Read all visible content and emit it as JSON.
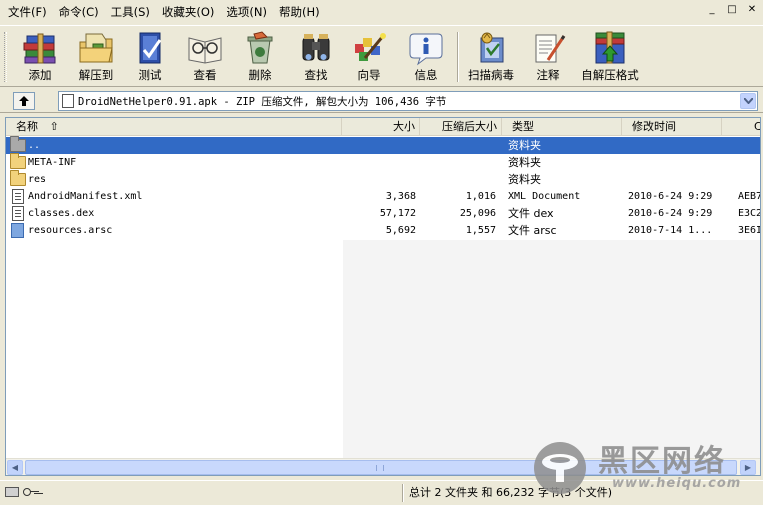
{
  "menu": [
    "文件(F)",
    "命令(C)",
    "工具(S)",
    "收藏夹(O)",
    "选项(N)",
    "帮助(H)"
  ],
  "window_controls": {
    "minimize": "_",
    "maximize": "□",
    "close": "✕"
  },
  "toolbar": {
    "add": "添加",
    "extract": "解压到",
    "test": "测试",
    "view": "查看",
    "delete": "删除",
    "find": "查找",
    "wizard": "向导",
    "info": "信息",
    "scan": "扫描病毒",
    "comment": "注释",
    "sfx": "自解压格式"
  },
  "address": {
    "path": "DroidNetHelper0.91.apk - ZIP 压缩文件, 解包大小为 106,436 字节"
  },
  "columns": {
    "name": "名称",
    "size": "大小",
    "packed": "压缩后大小",
    "type": "类型",
    "modified": "修改时间",
    "crc": "C"
  },
  "files": [
    {
      "name": "..",
      "size": "",
      "packed": "",
      "type": "资料夹",
      "modified": "",
      "crc": "",
      "icon": "folder-up-icon",
      "selected": true
    },
    {
      "name": "META-INF",
      "size": "",
      "packed": "",
      "type": "资料夹",
      "modified": "",
      "crc": "",
      "icon": "folder-icon"
    },
    {
      "name": "res",
      "size": "",
      "packed": "",
      "type": "资料夹",
      "modified": "",
      "crc": "",
      "icon": "folder-icon"
    },
    {
      "name": "AndroidManifest.xml",
      "size": "3,368",
      "packed": "1,016",
      "type": "XML Document",
      "modified": "2010-6-24 9:29",
      "crc": "AEB7",
      "icon": "document-icon"
    },
    {
      "name": "classes.dex",
      "size": "57,172",
      "packed": "25,096",
      "type": "文件 dex",
      "modified": "2010-6-24 9:29",
      "crc": "E3C2",
      "icon": "document-icon"
    },
    {
      "name": "resources.arsc",
      "size": "5,692",
      "packed": "1,557",
      "type": "文件 arsc",
      "modified": "2010-7-14 1...",
      "crc": "3E6I",
      "icon": "file-icon"
    }
  ],
  "status": {
    "text": "总计 2 文件夹 和 66,232 字节(3 个文件)"
  },
  "watermark": {
    "title": "黑区网络",
    "url": "www.heiqu.com"
  }
}
